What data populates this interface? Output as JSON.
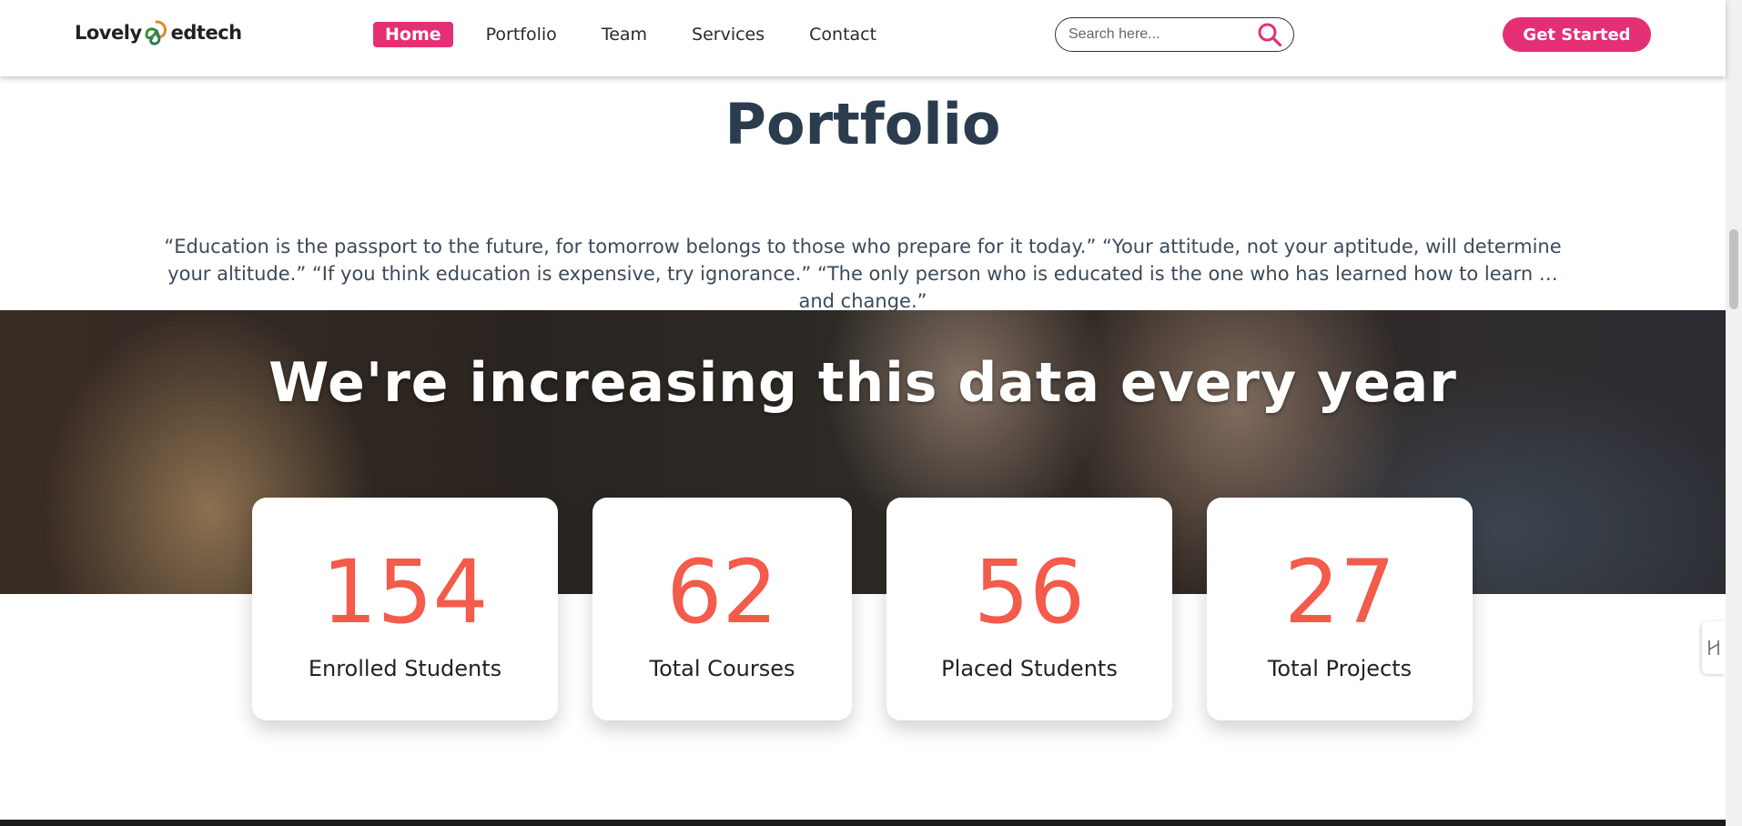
{
  "header": {
    "logo_left": "Lovely",
    "logo_right": "edtech",
    "nav": [
      {
        "label": "Home",
        "active": true
      },
      {
        "label": "Portfolio",
        "active": false
      },
      {
        "label": "Team",
        "active": false
      },
      {
        "label": "Services",
        "active": false
      },
      {
        "label": "Contact",
        "active": false
      }
    ],
    "search_placeholder": "Search here...",
    "cta_label": "Get Started"
  },
  "main": {
    "title": "Portfolio",
    "quote": "“Education is the passport to the future, for tomorrow belongs to those who prepare for it today.” “Your attitude, not your aptitude, will determine your altitude.” “If you think education is expensive, try ignorance.” “The only person who is educated is the one who has learned how to learn …and change.”"
  },
  "banner": {
    "title": "We're increasing this data every year"
  },
  "stats": [
    {
      "value": "154",
      "label": "Enrolled Students"
    },
    {
      "value": "62",
      "label": "Total Courses"
    },
    {
      "value": "56",
      "label": "Placed Students"
    },
    {
      "value": "27",
      "label": "Total Projects"
    }
  ],
  "colors": {
    "accent": "#e42f75",
    "stat_value": "#f35b4a",
    "title": "#2b3c4e"
  },
  "icons": {
    "search": "search-icon",
    "logo": "logo-mark-icon",
    "side_tab": "expand-icon"
  }
}
